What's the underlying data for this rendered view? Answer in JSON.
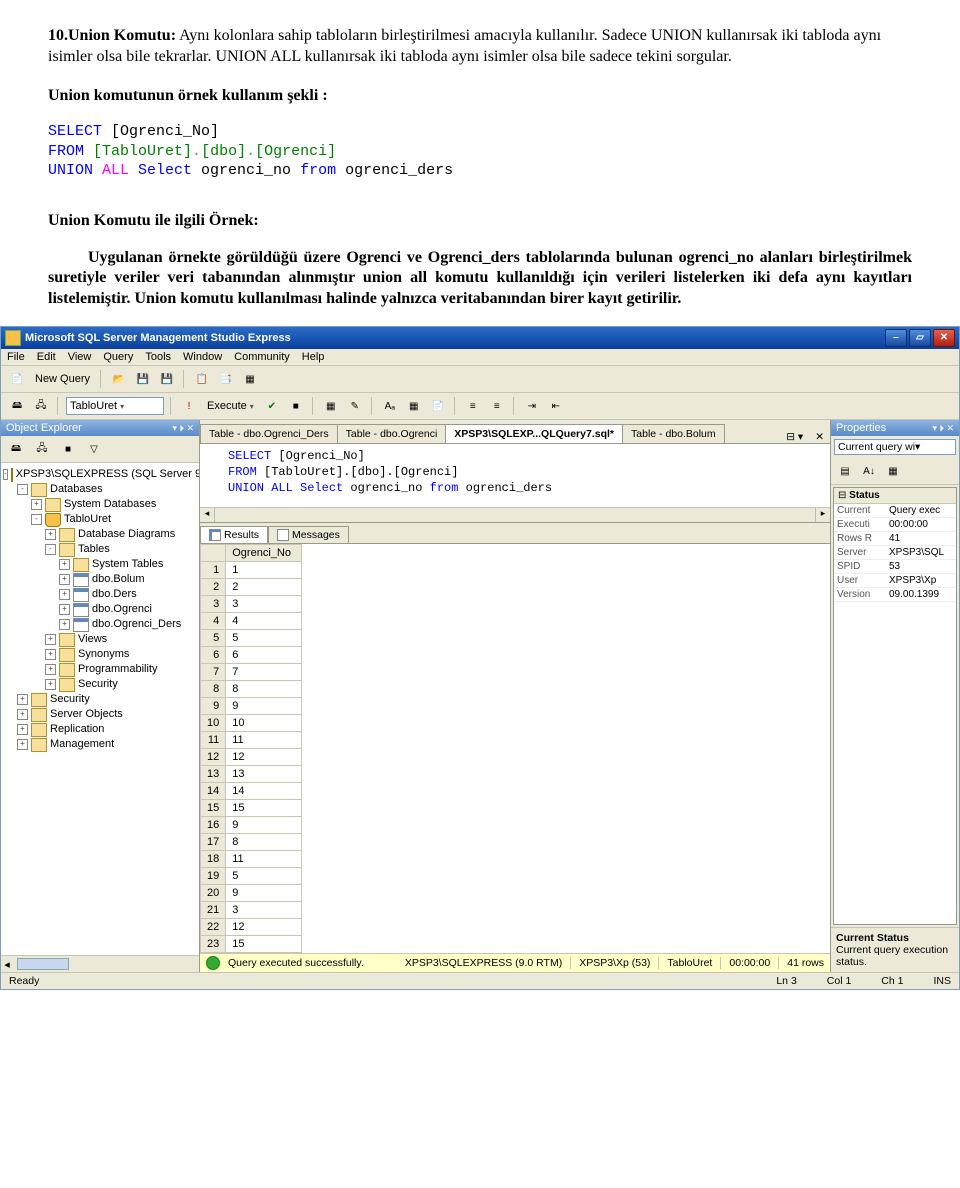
{
  "doc": {
    "heading_num": "10.",
    "heading_term": "Union Komutu:",
    "para1_rest": " Aynı kolonlara sahip tabloların birleştirilmesi amacıyla kullanılır. Sadece UNION kullanırsak iki tabloda aynı isimler olsa bile tekrarlar. UNION ALL kullanırsak iki tabloda aynı isimler olsa bile sadece tekini sorgular.",
    "para2": "Union komutunun örnek kullanım şekli :",
    "code": {
      "l1a": "SELECT",
      "l1b": " [Ogrenci_No]",
      "l2a": "FROM",
      "l2b": " [TabloUret]",
      "l2c": ".",
      "l2d": "[dbo]",
      "l2e": ".",
      "l2f": "[Ogrenci]",
      "l3a": "UNION",
      "l3b": " ALL",
      "l3c": " Select",
      "l3d": " ogrenci_no ",
      "l3e": "from",
      "l3f": " ogrenci_ders"
    },
    "para3_title": "Union Komutu ile ilgili Örnek:",
    "para4": "Uygulanan örnekte görüldüğü üzere Ogrenci ve Ogrenci_ders tablolarında bulunan ogrenci_no alanları birleştirilmek suretiyle veriler veri tabanından alınmıştır union all komutu kullanıldığı için verileri listelerken iki defa aynı kayıtları listelemiştir. Union komutu kullanılması halinde yalnızca veritabanından birer kayıt getirilir."
  },
  "ssms": {
    "title": "Microsoft SQL Server Management Studio Express",
    "menu": [
      "File",
      "Edit",
      "View",
      "Query",
      "Tools",
      "Window",
      "Community",
      "Help"
    ],
    "newQuery": "New Query",
    "dbCombo": "TabloUret",
    "execute": "Execute",
    "objExpl": "Object Explorer",
    "autoHide": "▾ ⏷ ✕",
    "tree": [
      {
        "ind": 0,
        "exp": "-",
        "ico": "server",
        "label": "XPSP3\\SQLEXPRESS (SQL Server 9"
      },
      {
        "ind": 1,
        "exp": "-",
        "ico": "folder",
        "label": "Databases"
      },
      {
        "ind": 2,
        "exp": "+",
        "ico": "folder",
        "label": "System Databases"
      },
      {
        "ind": 2,
        "exp": "-",
        "ico": "db",
        "label": "TabloUret"
      },
      {
        "ind": 3,
        "exp": "+",
        "ico": "folder",
        "label": "Database Diagrams"
      },
      {
        "ind": 3,
        "exp": "-",
        "ico": "folder",
        "label": "Tables"
      },
      {
        "ind": 4,
        "exp": "+",
        "ico": "folder",
        "label": "System Tables"
      },
      {
        "ind": 4,
        "exp": "+",
        "ico": "table",
        "label": "dbo.Bolum"
      },
      {
        "ind": 4,
        "exp": "+",
        "ico": "table",
        "label": "dbo.Ders"
      },
      {
        "ind": 4,
        "exp": "+",
        "ico": "table",
        "label": "dbo.Ogrenci"
      },
      {
        "ind": 4,
        "exp": "+",
        "ico": "table",
        "label": "dbo.Ogrenci_Ders"
      },
      {
        "ind": 3,
        "exp": "+",
        "ico": "folder",
        "label": "Views"
      },
      {
        "ind": 3,
        "exp": "+",
        "ico": "folder",
        "label": "Synonyms"
      },
      {
        "ind": 3,
        "exp": "+",
        "ico": "folder",
        "label": "Programmability"
      },
      {
        "ind": 3,
        "exp": "+",
        "ico": "folder",
        "label": "Security"
      },
      {
        "ind": 1,
        "exp": "+",
        "ico": "folder",
        "label": "Security"
      },
      {
        "ind": 1,
        "exp": "+",
        "ico": "folder",
        "label": "Server Objects"
      },
      {
        "ind": 1,
        "exp": "+",
        "ico": "folder",
        "label": "Replication"
      },
      {
        "ind": 1,
        "exp": "+",
        "ico": "folder",
        "label": "Management"
      }
    ],
    "tabs": [
      {
        "label": "Table - dbo.Ogrenci_Ders",
        "active": false
      },
      {
        "label": "Table - dbo.Ogrenci",
        "active": false
      },
      {
        "label": "XPSP3\\SQLEXP...QLQuery7.sql*",
        "active": true
      },
      {
        "label": "Table - dbo.Bolum",
        "active": false
      }
    ],
    "sql": {
      "l1a": "SELECT",
      "l1b": " [Ogrenci_No]",
      "l2a": "FROM",
      "l2b": " [TabloUret].[dbo].[Ogrenci]",
      "l3a": "UNION ALL",
      "l3b": " Select ",
      "l3c": "ogrenci_no ",
      "l3d": "from ",
      "l3e": "ogrenci_ders"
    },
    "resTabs": {
      "results": "Results",
      "messages": "Messages"
    },
    "gridHeader": "Ogrenci_No",
    "gridRows": [
      {
        "n": "1",
        "v": "1"
      },
      {
        "n": "2",
        "v": "2"
      },
      {
        "n": "3",
        "v": "3"
      },
      {
        "n": "4",
        "v": "4"
      },
      {
        "n": "5",
        "v": "5"
      },
      {
        "n": "6",
        "v": "6"
      },
      {
        "n": "7",
        "v": "7"
      },
      {
        "n": "8",
        "v": "8"
      },
      {
        "n": "9",
        "v": "9"
      },
      {
        "n": "10",
        "v": "10"
      },
      {
        "n": "11",
        "v": "11"
      },
      {
        "n": "12",
        "v": "12"
      },
      {
        "n": "13",
        "v": "13"
      },
      {
        "n": "14",
        "v": "14"
      },
      {
        "n": "15",
        "v": "15"
      },
      {
        "n": "16",
        "v": "9"
      },
      {
        "n": "17",
        "v": "8"
      },
      {
        "n": "18",
        "v": "11"
      },
      {
        "n": "19",
        "v": "5"
      },
      {
        "n": "20",
        "v": "9"
      },
      {
        "n": "21",
        "v": "3"
      },
      {
        "n": "22",
        "v": "12"
      },
      {
        "n": "23",
        "v": "15"
      }
    ],
    "statusYellow": {
      "msg": "Query executed successfully.",
      "server": "XPSP3\\SQLEXPRESS (9.0 RTM)",
      "user": "XPSP3\\Xp (53)",
      "db": "TabloUret",
      "time": "00:00:00",
      "rows": "41 rows"
    },
    "props": {
      "title": "Properties",
      "subtitle": "Current query wi",
      "section": "Status",
      "rows": [
        {
          "k": "Current",
          "v": "Query exec"
        },
        {
          "k": "Executi",
          "v": "00:00:00"
        },
        {
          "k": "Rows R",
          "v": "41"
        },
        {
          "k": "Server",
          "v": "XPSP3\\SQL"
        },
        {
          "k": "SPID",
          "v": "53"
        },
        {
          "k": "User",
          "v": "XPSP3\\Xp"
        },
        {
          "k": "Version",
          "v": "09.00.1399"
        }
      ],
      "footTitle": "Current Status",
      "footDesc": "Current query execution status."
    },
    "statusbar": {
      "ready": "Ready",
      "ln": "Ln 3",
      "col": "Col 1",
      "ch": "Ch 1",
      "ins": "INS"
    }
  }
}
